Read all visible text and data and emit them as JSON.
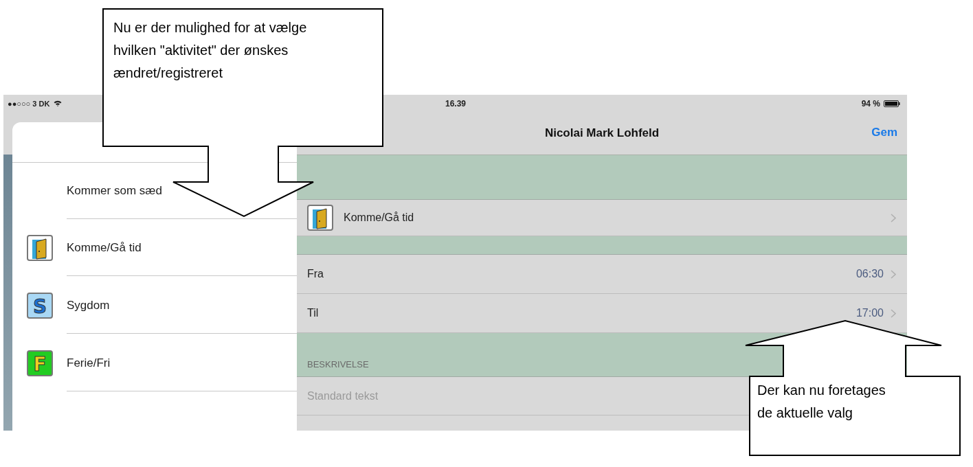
{
  "status_bar": {
    "carrier": "●●○○○ 3 DK",
    "time": "16.39",
    "battery": "94 %"
  },
  "popover": {
    "items": [
      {
        "label": "Kommer som sæd",
        "kind": "plain"
      },
      {
        "label": "Komme/Gå tid",
        "kind": "door"
      },
      {
        "label": "Sygdom",
        "kind": "letter",
        "icon_letter": "S",
        "color": "#a9d8f5"
      },
      {
        "label": "Ferie/Fri",
        "kind": "letter",
        "icon_letter": "F",
        "color": "#22cc22"
      }
    ]
  },
  "nav": {
    "title": "Nicolai Mark Lohfeld",
    "save_button": "Gem"
  },
  "form": {
    "rows": [
      {
        "kind": "spacer"
      },
      {
        "kind": "activity",
        "label": "Komme/Gå tid"
      },
      {
        "kind": "gap"
      },
      {
        "kind": "value",
        "label": "Fra",
        "value": "06:30"
      },
      {
        "kind": "value",
        "label": "Til",
        "value": "17:00"
      },
      {
        "kind": "section",
        "header": "BESKRIVELSE"
      },
      {
        "kind": "input",
        "placeholder": "Standard tekst"
      }
    ]
  },
  "callouts": [
    {
      "text": "Nu er der mulighed for at vælge hvilken \"aktivitet\" der ønskes ændret/registreret"
    },
    {
      "text": "Der kan nu foretages de aktuelle valg"
    }
  ]
}
